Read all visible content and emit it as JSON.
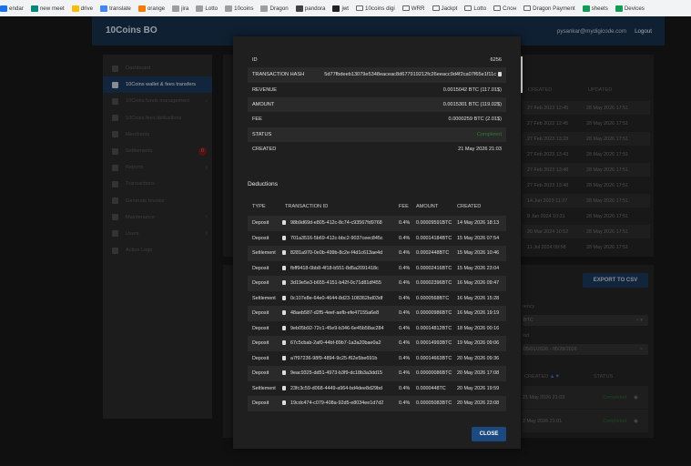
{
  "bookmarks": [
    {
      "label": "endar",
      "icon": "calendar-icon",
      "color": "#1a73e8"
    },
    {
      "label": "new meet",
      "icon": "meet-icon",
      "color": "#00897b"
    },
    {
      "label": "drive",
      "icon": "drive-icon",
      "color": "#fbbc04"
    },
    {
      "label": "translate",
      "icon": "translate-icon",
      "color": "#4285f4"
    },
    {
      "label": "orange",
      "icon": "orange-icon",
      "color": "#f57c00"
    },
    {
      "label": "jira",
      "icon": "jira-icon",
      "color": "#9e9e9e"
    },
    {
      "label": "Lotto",
      "icon": "lotto-icon",
      "color": "#9e9e9e"
    },
    {
      "label": "10coins",
      "icon": "coins-icon",
      "color": "#9e9e9e"
    },
    {
      "label": "Dragon",
      "icon": "dragon-icon",
      "color": "#9e9e9e"
    },
    {
      "label": "pandora",
      "icon": "lock-icon",
      "color": "#424242"
    },
    {
      "label": "jwt",
      "icon": "jwt-icon",
      "color": "#212121"
    },
    {
      "label": "10coins digi",
      "icon": "folder-icon",
      "color": ""
    },
    {
      "label": "WRR",
      "icon": "folder-icon",
      "color": ""
    },
    {
      "label": "Jackpt",
      "icon": "folder-icon",
      "color": ""
    },
    {
      "label": "Lotto",
      "icon": "folder-icon",
      "color": ""
    },
    {
      "label": "Слон",
      "icon": "folder-icon",
      "color": ""
    },
    {
      "label": "Dragon Payment",
      "icon": "folder-icon",
      "color": ""
    },
    {
      "label": "sheets",
      "icon": "sheets-icon",
      "color": "#0f9d58"
    },
    {
      "label": "Devices",
      "icon": "devices-icon",
      "color": "#0f9d58"
    }
  ],
  "header": {
    "title": "10Coins BO",
    "user": "pysankar@mydigicode.com",
    "logout": "Logout"
  },
  "sidebar": {
    "items": [
      {
        "label": "Dashboard",
        "icon": "dashboard-icon",
        "active": false,
        "chevron": false
      },
      {
        "label": "10Coins wallet & fees transfers",
        "icon": "wallet-icon",
        "active": true,
        "chevron": false
      },
      {
        "label": "10Coins funds management",
        "icon": "funds-icon",
        "active": false,
        "chevron": true
      },
      {
        "label": "10Coins fees deductions",
        "icon": "scissors-icon",
        "active": false,
        "chevron": false
      },
      {
        "label": "Merchants",
        "icon": "merchants-icon",
        "active": false,
        "chevron": false
      },
      {
        "label": "Settlements",
        "icon": "settlements-icon",
        "active": false,
        "badge": "0"
      },
      {
        "label": "Reports",
        "icon": "reports-icon",
        "active": false,
        "chevron": true
      },
      {
        "label": "Transactions",
        "icon": "history-icon",
        "active": false,
        "chevron": false
      },
      {
        "label": "Generate Invoice",
        "icon": "invoice-icon",
        "active": false,
        "chevron": false
      },
      {
        "label": "Maintenance",
        "icon": "maintenance-icon",
        "active": false,
        "chevron": true
      },
      {
        "label": "Users",
        "icon": "users-icon",
        "active": false,
        "chevron": true
      },
      {
        "label": "Action Logs",
        "icon": "logs-icon",
        "active": false,
        "chevron": false
      }
    ]
  },
  "background": {
    "col_created": "CREATED",
    "col_updated": "UPDATED",
    "rows": [
      {
        "created": "27 Feb 2023 12:45",
        "updated": "28 May 2026 17:51"
      },
      {
        "created": "27 Feb 2023 12:45",
        "updated": "28 May 2026 17:51"
      },
      {
        "created": "27 Feb 2023 13:28",
        "updated": "28 May 2026 17:51"
      },
      {
        "created": "27 Feb 2023 13:43",
        "updated": "28 May 2026 17:51"
      },
      {
        "created": "27 Feb 2023 13:48",
        "updated": "28 May 2026 17:51"
      },
      {
        "created": "27 Feb 2023 13:48",
        "updated": "28 May 2026 17:51"
      },
      {
        "created": "14 Jun 2023 11:27",
        "updated": "28 May 2026 17:51"
      },
      {
        "created": "9 Jan 2024 10:31",
        "updated": "28 May 2026 17:51"
      },
      {
        "created": "20 Mar 2024 10:52",
        "updated": "28 May 2026 17:51"
      },
      {
        "created": "11 Jul 2024 09:58",
        "updated": "28 May 2026 17:51"
      }
    ],
    "export_label": "EXPORT TO CSV",
    "currency_label": "rency",
    "currency_value": "BTC",
    "period_label": "iod",
    "period_value": "05/01/2026 - 05/28/2026",
    "col_created2": "CREATED",
    "col_status": "STATUS",
    "status_rows": [
      {
        "created": "21 May 2026 21:03",
        "status": "Completed"
      },
      {
        "created": "2 May 2026 21:01",
        "status": "Completed"
      }
    ]
  },
  "modal": {
    "details": [
      {
        "key": "ID",
        "value": "6256"
      },
      {
        "key": "TRANSACTION HASH",
        "value": "5d77fbdeeb13079e5348eaceac8d677919212fc26eeacc9d4f2ca07f65e1f11c",
        "copy": true
      },
      {
        "key": "REVENUE",
        "value": "0.0015042 BTC (117.01$)"
      },
      {
        "key": "AMOUNT",
        "value": "0.0015301 BTC (119.02$)"
      },
      {
        "key": "FEE",
        "value": "0.0000259 BTC (2.01$)"
      },
      {
        "key": "STATUS",
        "value": "Completed",
        "green": true
      },
      {
        "key": "CREATED",
        "value": "21 May 2026 21:03"
      }
    ],
    "deductions_title": "Deductions",
    "deductions_headers": {
      "type": "TYPE",
      "txid": "TRANSACTION ID",
      "fee": "FEE",
      "amount": "AMOUNT",
      "created": "CREATED"
    },
    "deductions": [
      {
        "type": "Deposit",
        "txid": "98b9d69d-e805-412c-8c74-c93567fd9768",
        "fee": "0.4%",
        "amount": "0.00009591BTC",
        "created": "14 May 2026 18:13"
      },
      {
        "type": "Deposit",
        "txid": "701a3516-5b69-412c-bbc2-9037ceec845c",
        "fee": "0.4%",
        "amount": "0.00014184BTC",
        "created": "15 May 2026 07:54"
      },
      {
        "type": "Settlement",
        "txid": "8281a970-0e0b-499b-8c2e-f4d1c613ae4d",
        "fee": "0.4%",
        "amount": "0.0002448BTC",
        "created": "15 May 2026 10:46"
      },
      {
        "type": "Deposit",
        "txid": "fbff9418-0bb8-4f18-b551-8d5a2091418c",
        "fee": "0.4%",
        "amount": "0.00002416BTC",
        "created": "15 May 2026 23:04"
      },
      {
        "type": "Deposit",
        "txid": "3d19e5e3-b655-4151-b42f-0c71d81df455",
        "fee": "0.4%",
        "amount": "0.00002396BTC",
        "created": "16 May 2026 09:47"
      },
      {
        "type": "Settlement",
        "txid": "0c107e8e-64e0-4644-8d23-108362bd03df",
        "fee": "0.4%",
        "amount": "0.0000568BTC",
        "created": "16 May 2026 15:28"
      },
      {
        "type": "Deposit",
        "txid": "48aeb587-d2f5-4eef-aefb-efe47155a6e8",
        "fee": "0.4%",
        "amount": "0.00000986BTC",
        "created": "16 May 2026 19:19"
      },
      {
        "type": "Deposit",
        "txid": "9eb05b92-72c1-45e9-b346-6e45b58ac284",
        "fee": "0.4%",
        "amount": "0.00014812BTC",
        "created": "18 May 2026 00:16"
      },
      {
        "type": "Deposit",
        "txid": "67c5cbab-2af0-44bf-89b7-1a3a20bae0a2",
        "fee": "0.4%",
        "amount": "0.00014993BTC",
        "created": "19 May 2026 09:06"
      },
      {
        "type": "Deposit",
        "txid": "a7f97236-98f9-4894-9c25-f62e5be691b",
        "fee": "0.4%",
        "amount": "0.00014663BTC",
        "created": "20 May 2026 09:36"
      },
      {
        "type": "Deposit",
        "txid": "9eac9325-dd51-4973-b3f9-dc18b3a3dd15",
        "fee": "0.4%",
        "amount": "0.00000086BTC",
        "created": "20 May 2026 17:08"
      },
      {
        "type": "Settlement",
        "txid": "23fc3c59-d068-4449-a964-bd4dee8d29bd",
        "fee": "0.4%",
        "amount": "0.0000448TC",
        "created": "20 May 2026 19:59"
      },
      {
        "type": "Deposit",
        "txid": "19cdc474-c079-408a-92d5-e8034ee1d7d2",
        "fee": "0.4%",
        "amount": "0.00005083BTC",
        "created": "20 May 2026 23:08"
      }
    ],
    "close_label": "CLOSE"
  }
}
